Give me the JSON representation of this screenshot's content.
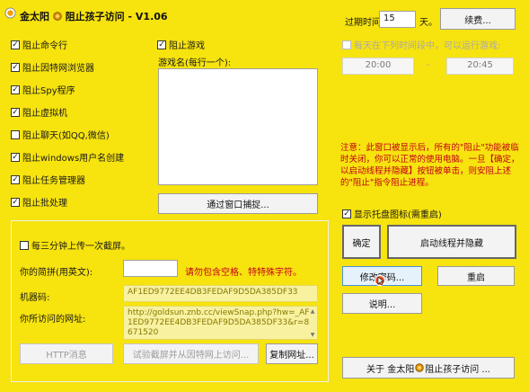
{
  "window": {
    "title": "金太阳",
    "title_rest": "阻止孩子访问 - V1.06"
  },
  "expiry": {
    "label": "过期时间:",
    "value": "15",
    "unit": "天。",
    "renew_button": "续费..."
  },
  "schedule": {
    "label": "每天在下列时间段中，可以运行游戏:",
    "from": "20:00",
    "separator": "-",
    "to": "20:45"
  },
  "blocks": [
    {
      "label": "阻止命令行",
      "checked": true
    },
    {
      "label": "阻止因特网浏览器",
      "checked": true
    },
    {
      "label": "阻止Spy程序",
      "checked": true
    },
    {
      "label": "阻止虚拟机",
      "checked": true
    },
    {
      "label": "阻止聊天(如QQ,微信)",
      "checked": false
    },
    {
      "label": "阻止windows用户名创建",
      "checked": true
    },
    {
      "label": "阻止任务管理器",
      "checked": true
    },
    {
      "label": "阻止批处理",
      "checked": true
    }
  ],
  "games": {
    "label": "阻止游戏",
    "checked": true,
    "list_label": "游戏名(每行一个):",
    "capture_button": "通过窗口捕捉..."
  },
  "note": {
    "text": "注意：此窗口被显示后，所有的\"阻止\"功能被临时关闭，你可以正常的使用电脑。一旦【确定，以启动线程并隐藏】按钮被单击，则安阻上述的\"阻止\"指令阻止进程。"
  },
  "tray": {
    "label": "显示托盘图标(需重启)",
    "checked": true
  },
  "actions": {
    "ok": "确定",
    "start_hide": "启动线程并隐藏",
    "change_password": "修改密码...",
    "restart": "重启",
    "help": "说明...",
    "about_prefix": "关于 金太阳",
    "about_suffix": "阻止孩子访问 ..."
  },
  "upload": {
    "label": "每三分钟上传一次截屏。",
    "checked": false,
    "pinyin_label": "你的简拼(用英文):",
    "pinyin_value": "",
    "pinyin_hint": "请勿包含空格、特特殊字符。",
    "machine_label": "机器码:",
    "machine_value": "AF1ED9772EE4DB3FEDAF9D5DA385DF33",
    "url_label": "你所访问的网址:",
    "url_value": "http://goldsun.znb.cc/viewSnap.php?hw=_AF1ED9772EE4DB3FEDAF9D5DA385DF33&r=8671520",
    "http_button": "HTTP消息",
    "test_button": "试验截屏并从因特网上访问...",
    "copy_button": "复制网址..."
  },
  "colors": {
    "background": "#f7e30e",
    "accent_red": "#c4001a",
    "button_face": "#f3f3f3"
  }
}
